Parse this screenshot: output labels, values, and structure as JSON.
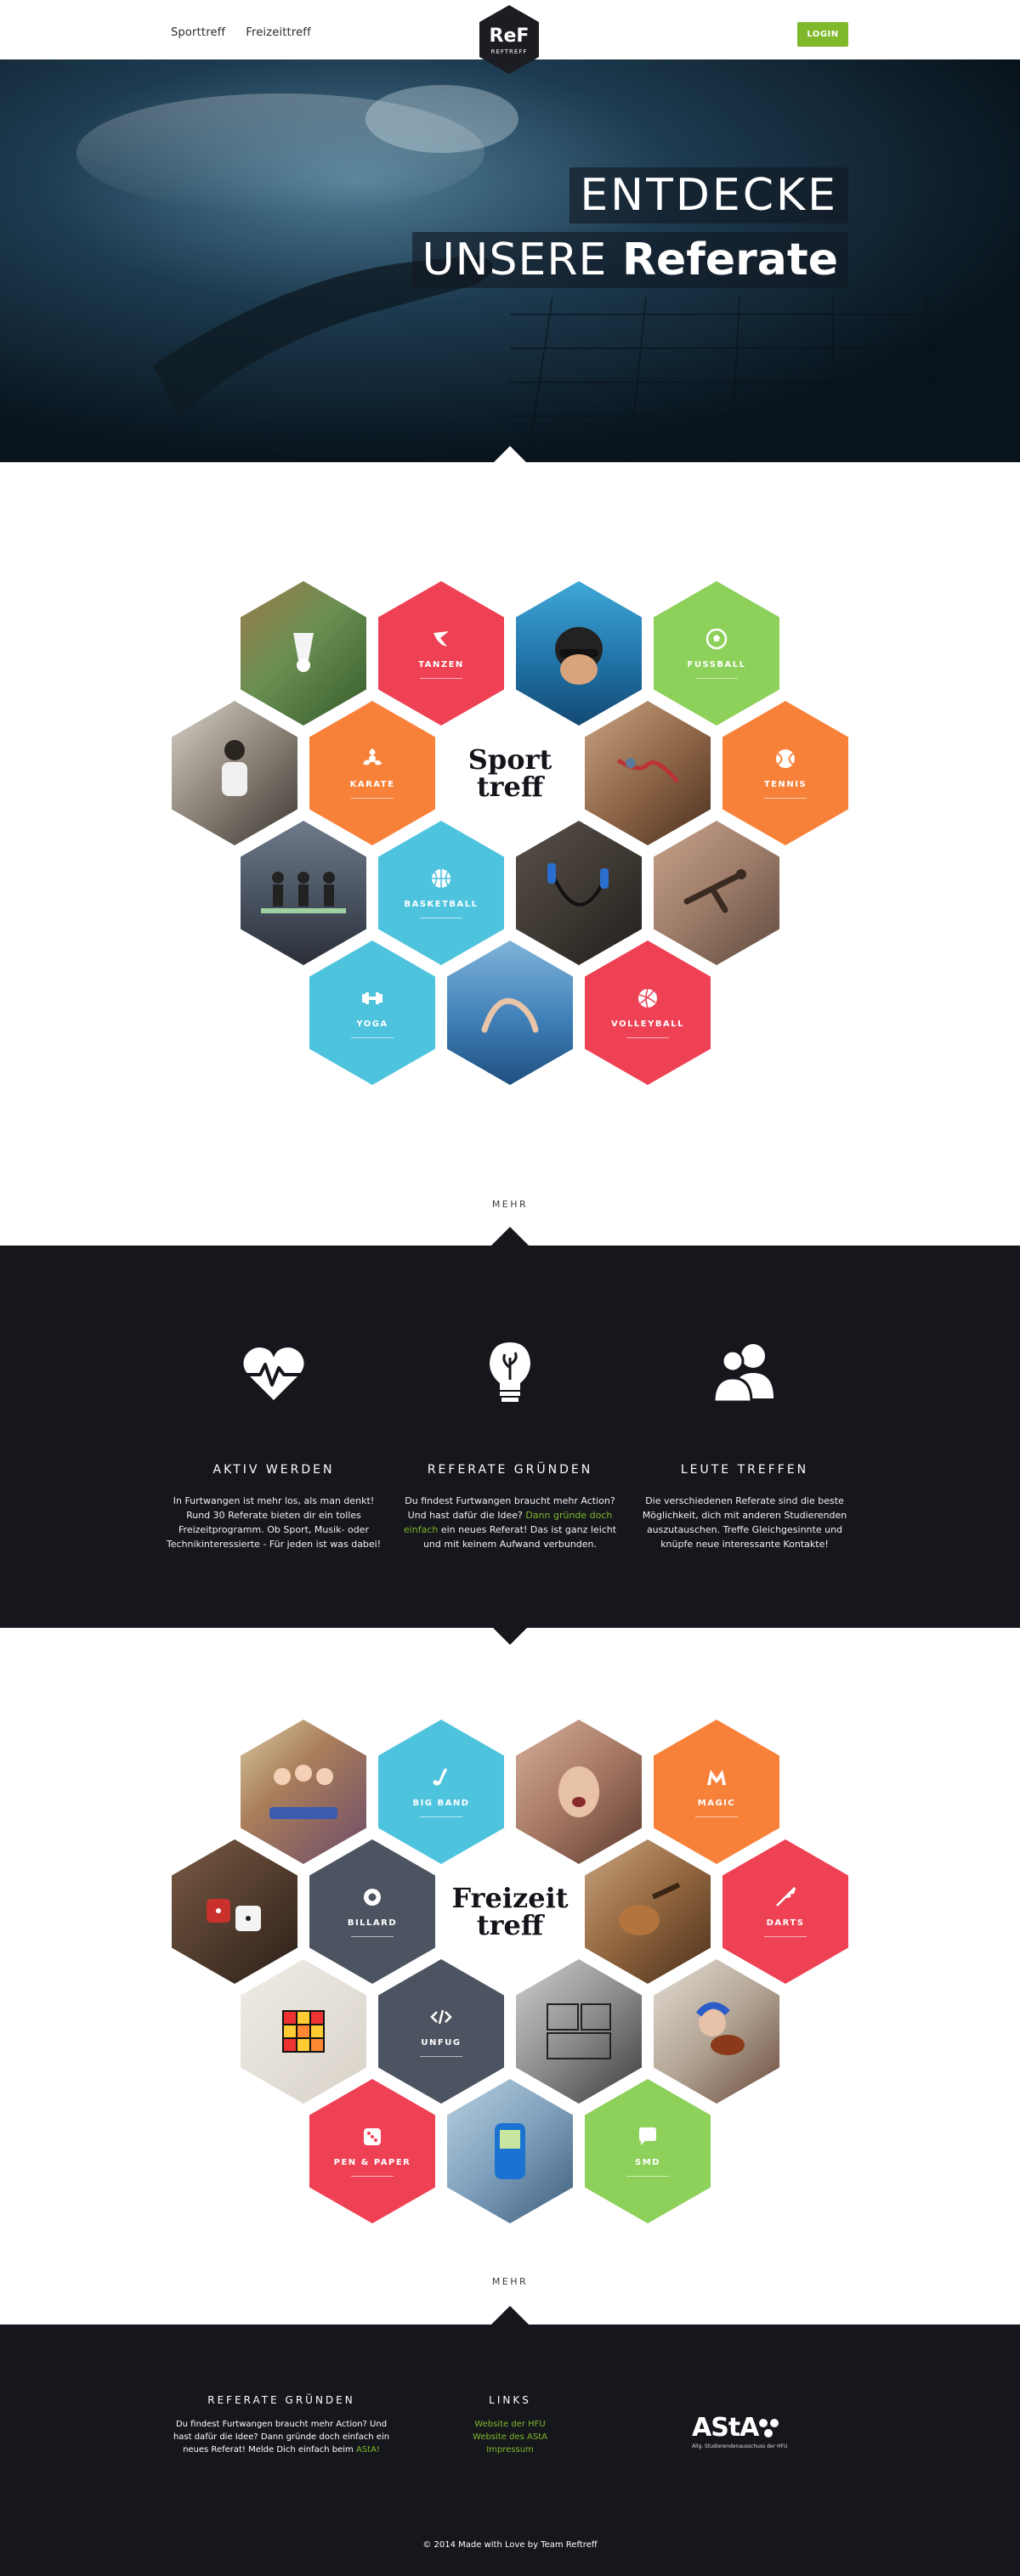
{
  "header": {
    "nav": [
      "Sporttreff",
      "Freizeittreff"
    ],
    "logo_text": "REFTREFF",
    "login_label": "LOGIN"
  },
  "hero": {
    "line1": "ENTDECKE",
    "line2_light": "UNSERE",
    "line2_bold": "Referate"
  },
  "sport": {
    "center_line1": "Sport",
    "center_line2": "treff",
    "tiles": [
      {
        "label": "TANZEN",
        "color": "#ee4154",
        "icon": "dancer-icon"
      },
      {
        "label": "FUSSBALL",
        "color": "#8dd05a",
        "icon": "football-icon"
      },
      {
        "label": "KARATE",
        "color": "#f8813a",
        "icon": "karate-icon"
      },
      {
        "label": "TENNIS",
        "color": "#f8813a",
        "icon": "tennis-ball-icon"
      },
      {
        "label": "BASKETBALL",
        "color": "#4ec3de",
        "icon": "basketball-icon"
      },
      {
        "label": "YOGA",
        "color": "#4ec3de",
        "icon": "dumbbell-icon"
      },
      {
        "label": "VOLLEYBALL",
        "color": "#ee4154",
        "icon": "volleyball-icon"
      }
    ],
    "more_label": "MEHR"
  },
  "features": [
    {
      "title": "AKTIV WERDEN",
      "icon": "heart-pulse-icon",
      "text": "In Furtwangen ist mehr los, als man denkt! Rund 30 Referate bieten dir ein tolles Freizeitprogramm. Ob Sport, Musik- oder Technikinteressierte - Für jeden ist was dabei!"
    },
    {
      "title": "REFERATE GRÜNDEN",
      "icon": "lightbulb-icon",
      "text_a": "Du findest Furtwangen braucht mehr Action? Und hast dafür die Idee? ",
      "text_link": "Dann gründe doch einfach",
      "text_b": " ein neues Referat! Das ist ganz leicht und mit keinem Aufwand verbunden."
    },
    {
      "title": "LEUTE TREFFEN",
      "icon": "users-icon",
      "text": "Die verschiedenen Referate sind die beste Möglichkeit, dich mit anderen Studierenden auszutauschen. Treffe Gleichgesinnte und knüpfe neue interessante Kontakte!"
    }
  ],
  "freizeit": {
    "center_line1": "Freizeit",
    "center_line2": "treff",
    "tiles": [
      {
        "label": "BIG BAND",
        "color": "#4ec3de",
        "icon": "saxophone-icon"
      },
      {
        "label": "MAGIC",
        "color": "#f8813a",
        "icon": "magic-icon"
      },
      {
        "label": "BILLARD",
        "color": "#4d5461",
        "icon": "billiard-ball-icon"
      },
      {
        "label": "DARTS",
        "color": "#ee4154",
        "icon": "dart-icon"
      },
      {
        "label": "UNFUG",
        "color": "#4d5461",
        "icon": "code-icon"
      },
      {
        "label": "PEN & PAPER",
        "color": "#ee4154",
        "icon": "dice-icon"
      },
      {
        "label": "SMD",
        "color": "#8dd05a",
        "icon": "chat-bubble-icon"
      }
    ],
    "more_label": "MEHR"
  },
  "footer": {
    "col1_title": "REFERATE GRÜNDEN",
    "col1_text": "Du findest Furtwangen braucht mehr Action? Und hast dafür die Idee? Dann gründe doch einfach ein neues Referat! Melde Dich einfach beim ",
    "col1_link": "AStA!",
    "col2_title": "LINKS",
    "links": [
      "Website der HFU",
      "Website des AStA",
      "Impressum"
    ],
    "asta_word": "AStA",
    "asta_sub": "Allg. Studierendenausschuss der HFU",
    "copyright": "© 2014 Made with Love by Team Reftreff"
  }
}
